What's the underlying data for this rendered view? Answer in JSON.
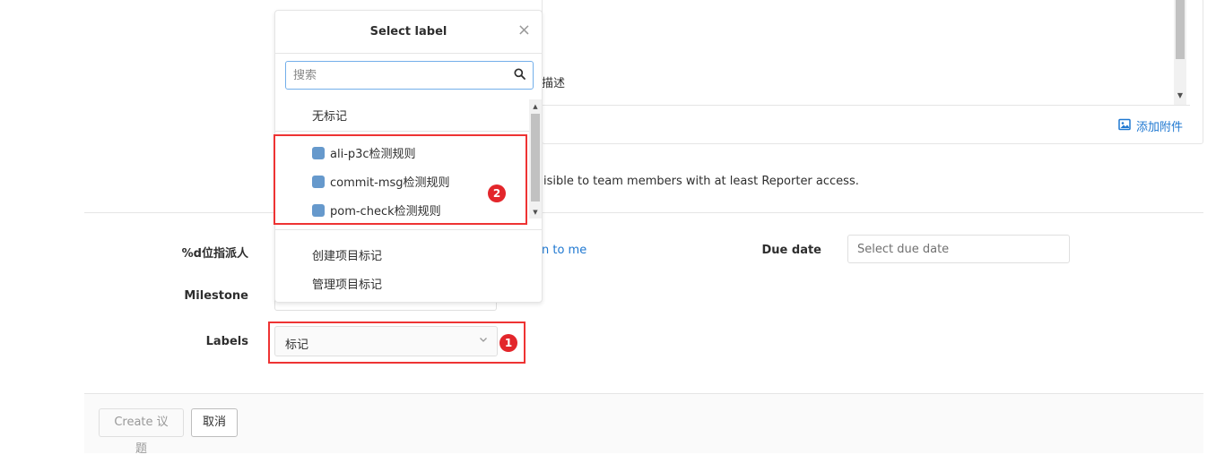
{
  "description": {
    "partial_text": "描述",
    "attach_label": "添加附件"
  },
  "confidential": {
    "partial_text": "isible to team members with at least Reporter access."
  },
  "form": {
    "assignee_label": "%d位指派人",
    "assign_to_me": "n to me",
    "due_date_label": "Due date",
    "due_date_placeholder": "Select due date",
    "milestone_label": "Milestone",
    "labels_label": "Labels",
    "labels_select_value": "标记"
  },
  "annotations": {
    "badge_1": "1",
    "badge_2": "2",
    "highlight_color": "#e33333"
  },
  "dropdown": {
    "title": "Select label",
    "search_placeholder": "搜索",
    "no_label": "无标记",
    "labels": [
      {
        "name": "ali-p3c检测规则",
        "color": "#6699cc"
      },
      {
        "name": "commit-msg检测规则",
        "color": "#6699cc"
      },
      {
        "name": "pom-check检测规则",
        "color": "#6699cc"
      }
    ],
    "footer_items": [
      "创建项目标记",
      "管理项目标记"
    ]
  },
  "footer": {
    "create_label": "Create 议题",
    "cancel_label": "取消"
  }
}
